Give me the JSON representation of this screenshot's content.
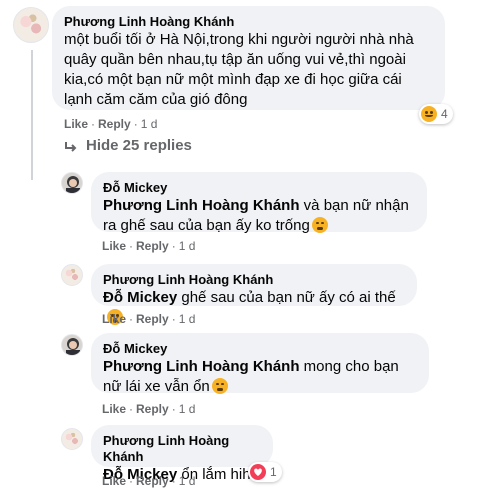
{
  "comments": [
    {
      "author": "Phương Linh Hoàng Khánh",
      "text": "một buổi tối ở Hà Nội,trong khi người người nhà nhà quây quần bên nhau,tụ tập ăn uống vui vẻ,thì ngoài kia,có một bạn nữ một mình đạp xe đi học giữa cái lạnh căm căm của gió đông",
      "like": "Like",
      "reply": "Reply",
      "time": "1 d",
      "reaction_count": "4"
    }
  ],
  "hide_replies_label": "Hide 25 replies",
  "replies": [
    {
      "author": "Đỗ Mickey",
      "mention": "Phương Linh Hoàng Khánh",
      "text": " và bạn nữ nhận ra ghế sau của bạn ấy ko trống",
      "like": "Like",
      "reply": "Reply",
      "time": "1 d"
    },
    {
      "author": "Phương Linh Hoàng Khánh",
      "mention": "Đỗ Mickey",
      "text": " ghế sau của bạn nữ ấy có ai thế",
      "like": "Like",
      "reply": "Reply",
      "time": "1 d"
    },
    {
      "author": "Đỗ Mickey",
      "mention": "Phương Linh Hoàng Khánh",
      "text": " mong cho bạn nữ lái xe vẫn ổn",
      "like": "Like",
      "reply": "Reply",
      "time": "1 d"
    },
    {
      "author": "Phương Linh Hoàng Khánh",
      "mention": "Đỗ Mickey",
      "text": " ổn lắm hihi",
      "like": "Like",
      "reply": "Reply",
      "time": "1 d",
      "reaction_count": "1"
    }
  ],
  "colors": {
    "bubble": "#f0f2f5",
    "secondary_text": "#65676b",
    "haha_yellow": "#f7b125",
    "love_red": "#f33e58"
  },
  "icons": [
    "hide-replies-arrow-icon",
    "sad-reaction-icon",
    "love-reaction-icon",
    "haha-reaction-icon",
    "wow-reaction-icon"
  ]
}
